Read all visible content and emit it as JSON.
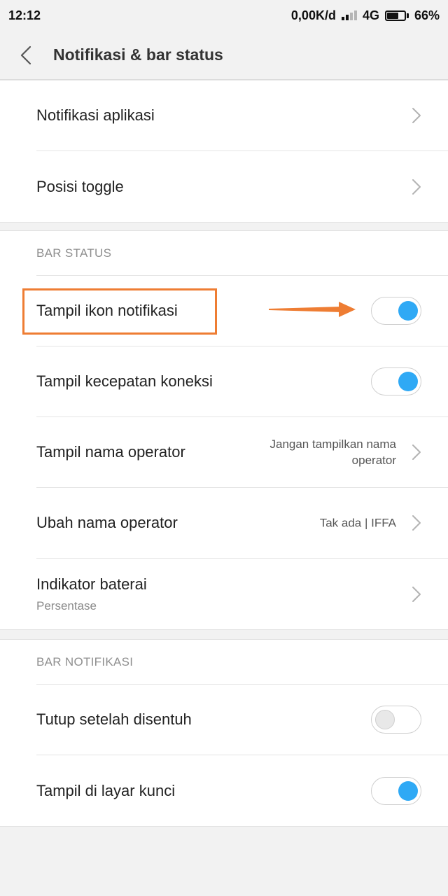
{
  "status_bar": {
    "time": "12:12",
    "network_speed": "0,00K/d",
    "network_type": "4G",
    "battery_percent": "66%",
    "battery_level": 0.66
  },
  "header": {
    "title": "Notifikasi & bar status",
    "back_icon": "chevron-left-icon"
  },
  "top_section": {
    "items": [
      {
        "label": "Notifikasi aplikasi"
      },
      {
        "label": "Posisi toggle"
      }
    ]
  },
  "bar_status": {
    "heading": "BAR STATUS",
    "items": [
      {
        "label": "Tampil ikon notifikasi",
        "toggle": true
      },
      {
        "label": "Tampil kecepatan koneksi",
        "toggle": true
      },
      {
        "label": "Tampil nama operator",
        "value": "Jangan tampilkan nama operator"
      },
      {
        "label": "Ubah nama operator",
        "value": "Tak ada | IFFA"
      },
      {
        "label": "Indikator baterai",
        "sublabel": "Persentase"
      }
    ]
  },
  "bar_notifikasi": {
    "heading": "BAR NOTIFIKASI",
    "items": [
      {
        "label": "Tutup setelah disentuh",
        "toggle": false
      },
      {
        "label": "Tampil di layar kunci",
        "toggle": true
      }
    ]
  },
  "colors": {
    "toggle_on": "#2fa9f5",
    "annotation": "#ee7d33"
  }
}
